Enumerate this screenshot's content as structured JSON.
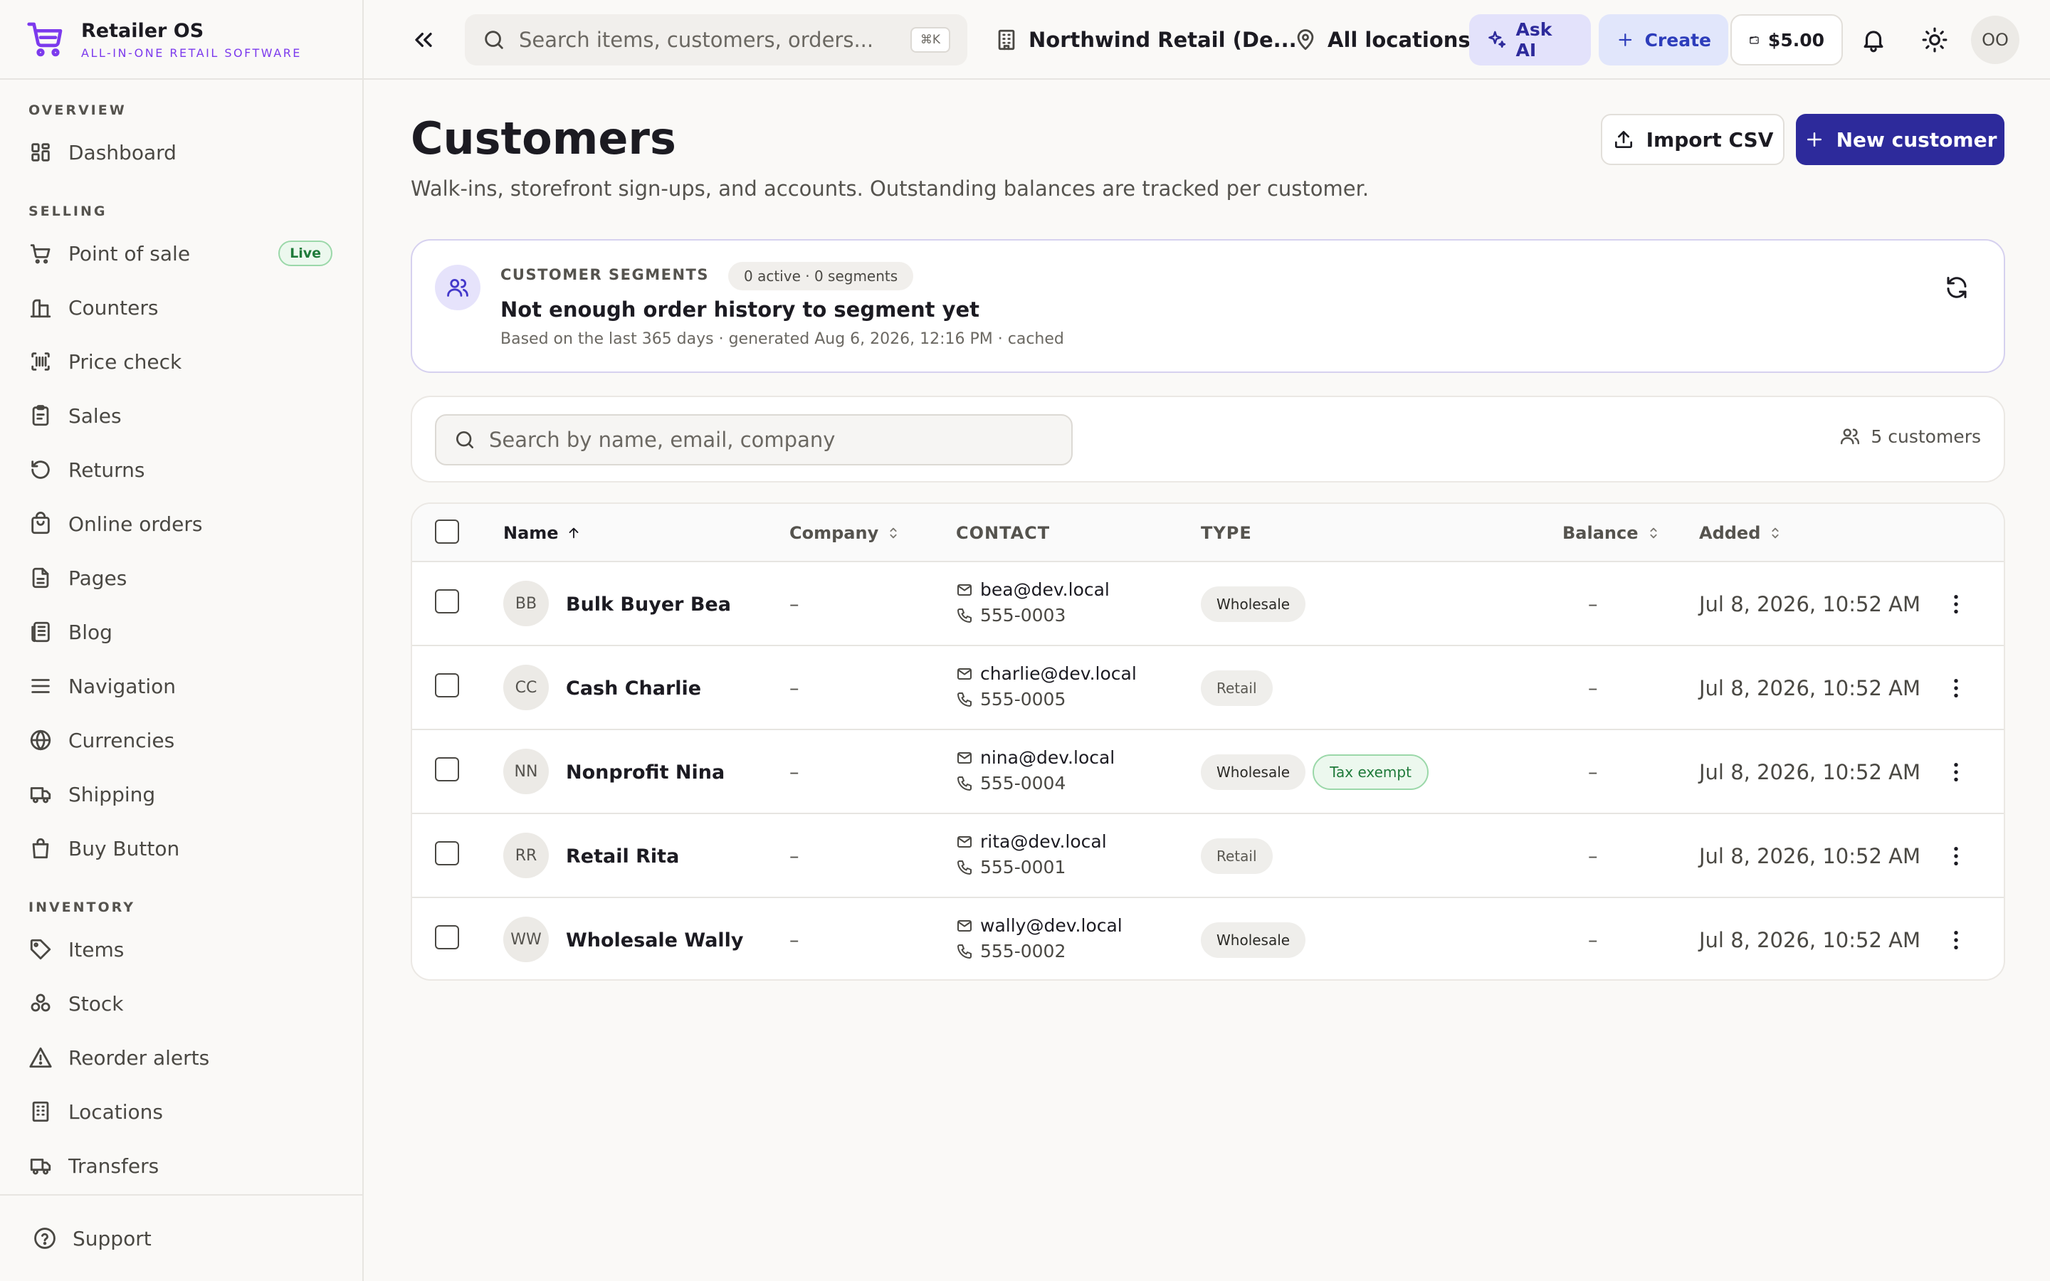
{
  "app": {
    "name": "Retailer OS",
    "tagline": "ALL-IN-ONE RETAIL SOFTWARE",
    "accent": "#7c3aed"
  },
  "sidebar": {
    "sections": [
      {
        "title": "OVERVIEW",
        "items": [
          {
            "label": "Dashboard",
            "icon": "dashboard-icon"
          }
        ]
      },
      {
        "title": "SELLING",
        "items": [
          {
            "label": "Point of sale",
            "icon": "cart-icon",
            "badge": "Live"
          },
          {
            "label": "Counters",
            "icon": "counter-icon"
          },
          {
            "label": "Price check",
            "icon": "barcode-icon"
          },
          {
            "label": "Sales",
            "icon": "clipboard-icon"
          },
          {
            "label": "Returns",
            "icon": "returns-icon"
          },
          {
            "label": "Online orders",
            "icon": "bag-icon"
          },
          {
            "label": "Pages",
            "icon": "page-icon"
          },
          {
            "label": "Blog",
            "icon": "newspaper-icon"
          },
          {
            "label": "Navigation",
            "icon": "menu-icon"
          },
          {
            "label": "Currencies",
            "icon": "globe-icon"
          },
          {
            "label": "Shipping",
            "icon": "truck-icon"
          },
          {
            "label": "Buy Button",
            "icon": "shopping-bag-icon"
          }
        ]
      },
      {
        "title": "INVENTORY",
        "items": [
          {
            "label": "Items",
            "icon": "tag-icon"
          },
          {
            "label": "Stock",
            "icon": "boxes-icon"
          },
          {
            "label": "Reorder alerts",
            "icon": "alert-icon"
          },
          {
            "label": "Locations",
            "icon": "building-icon"
          },
          {
            "label": "Transfers",
            "icon": "truck-icon"
          }
        ]
      }
    ],
    "footer": {
      "label": "Support",
      "icon": "help-icon"
    }
  },
  "topbar": {
    "search_placeholder": "Search items, customers, orders...",
    "search_shortcut": "⌘K",
    "org": "Northwind Retail (De...",
    "location": "All locations",
    "ask_ai": "Ask AI",
    "create": "Create",
    "balance": "$5.00",
    "user_initials": "OO"
  },
  "page": {
    "title": "Customers",
    "subtitle": "Walk-ins, storefront sign-ups, and accounts. Outstanding balances are tracked per customer.",
    "import_label": "Import CSV",
    "new_label": "New customer"
  },
  "segments": {
    "label": "CUSTOMER SEGMENTS",
    "badge": "0 active · 0 segments",
    "title": "Not enough order history to segment yet",
    "meta": "Based on the last 365 days · generated Aug 6, 2026, 12:16 PM · cached"
  },
  "customer_search": {
    "placeholder": "Search by name, email, company",
    "count": "5 customers"
  },
  "table": {
    "columns": {
      "name": "Name",
      "company": "Company",
      "contact": "CONTACT",
      "type": "TYPE",
      "balance": "Balance",
      "added": "Added"
    },
    "rows": [
      {
        "initials": "BB",
        "name": "Bulk Buyer Bea",
        "company": "–",
        "email": "bea@dev.local",
        "phone": "555-0003",
        "types": [
          "Wholesale"
        ],
        "balance": "–",
        "added": "Jul 8, 2026, 10:52 AM"
      },
      {
        "initials": "CC",
        "name": "Cash Charlie",
        "company": "–",
        "email": "charlie@dev.local",
        "phone": "555-0005",
        "types": [
          "Retail"
        ],
        "balance": "–",
        "added": "Jul 8, 2026, 10:52 AM"
      },
      {
        "initials": "NN",
        "name": "Nonprofit Nina",
        "company": "–",
        "email": "nina@dev.local",
        "phone": "555-0004",
        "types": [
          "Wholesale",
          "Tax exempt"
        ],
        "balance": "–",
        "added": "Jul 8, 2026, 10:52 AM"
      },
      {
        "initials": "RR",
        "name": "Retail Rita",
        "company": "–",
        "email": "rita@dev.local",
        "phone": "555-0001",
        "types": [
          "Retail"
        ],
        "balance": "–",
        "added": "Jul 8, 2026, 10:52 AM"
      },
      {
        "initials": "WW",
        "name": "Wholesale Wally",
        "company": "–",
        "email": "wally@dev.local",
        "phone": "555-0002",
        "types": [
          "Wholesale"
        ],
        "balance": "–",
        "added": "Jul 8, 2026, 10:52 AM"
      }
    ]
  }
}
